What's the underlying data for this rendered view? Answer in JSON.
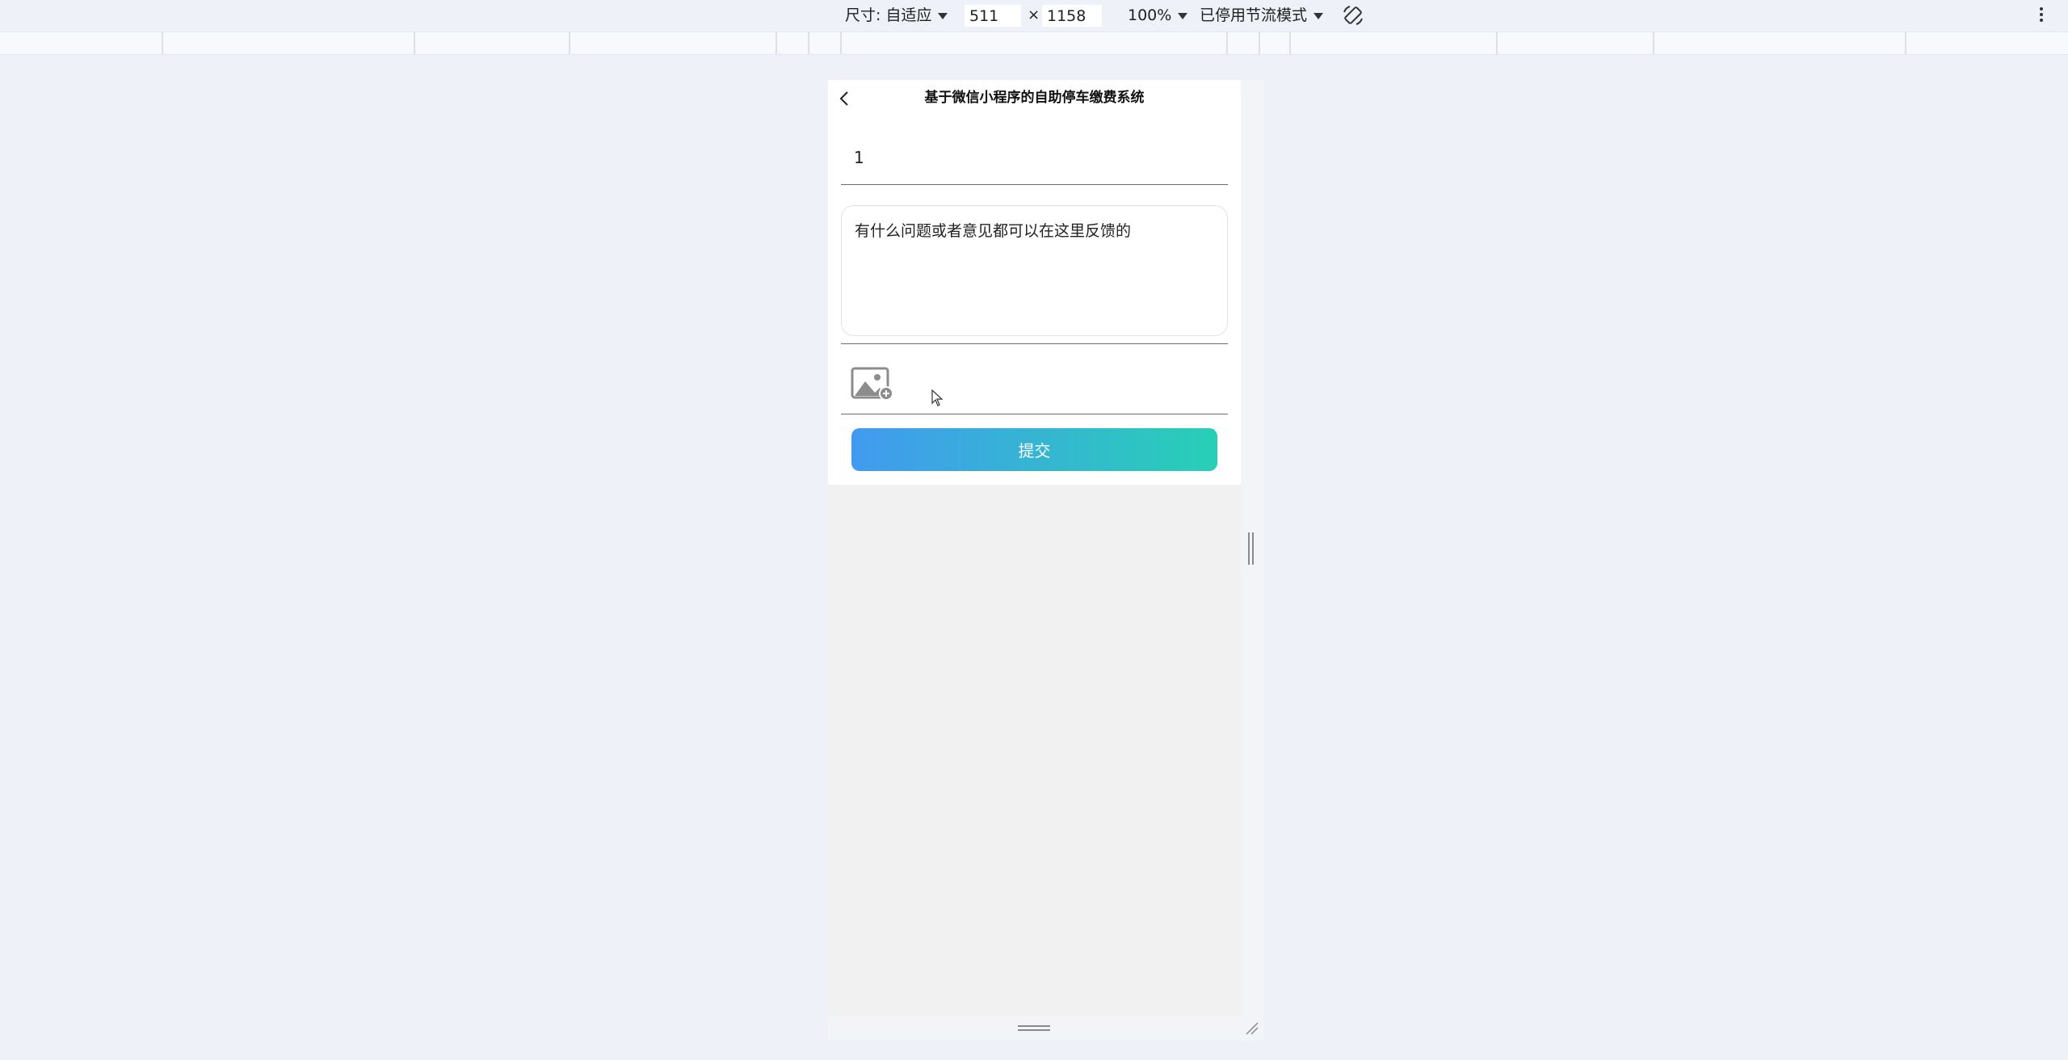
{
  "devtools": {
    "size_label": "尺寸: 自适应",
    "width_value": "511",
    "times_symbol": "×",
    "height_value": "1158",
    "zoom_label": "100%",
    "throttle_label": "已停用节流模式",
    "rotate_icon": "rotate-icon",
    "more_icon": "more-options-icon"
  },
  "app": {
    "nav_title": "基于微信小程序的自助停车缴费系统",
    "back_icon": "chevron-left-icon",
    "form": {
      "title_value": "1",
      "content_value": "有什么问题或者意见都可以在这里反馈的",
      "upload_icon": "image-add-icon",
      "submit_label": "提交"
    }
  },
  "colors": {
    "gradient_start": "#429af0",
    "gradient_end": "#28cfb6",
    "page_background": "#f1f1f1",
    "devtools_background": "#eef1f8"
  }
}
